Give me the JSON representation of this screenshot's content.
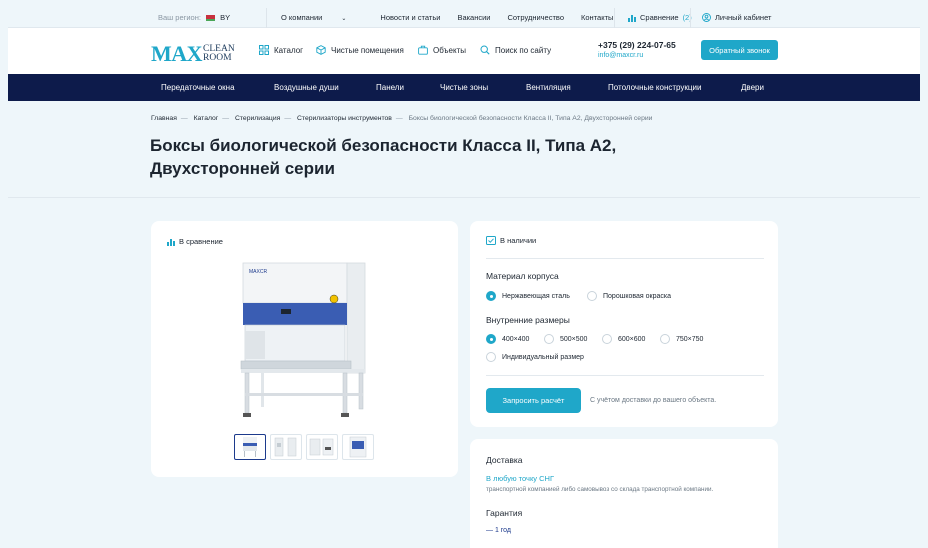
{
  "topbar": {
    "region_label": "Ваш регион:",
    "region_value": "BY",
    "nav": [
      "О компании",
      "Новости и статьи",
      "Вакансии",
      "Сотрудничество",
      "Контакты"
    ],
    "compare_label": "Сравнение",
    "compare_count": "(2)",
    "cabinet_label": "Личный кабинет"
  },
  "header": {
    "logo_max": "MAX",
    "logo_clean": "CLEAN",
    "logo_room": "ROOM",
    "nav": [
      "Каталог",
      "Чистые помещения",
      "Объекты",
      "Поиск по сайту"
    ],
    "phone": "+375 (29) 224-07-65",
    "email": "info@maxcr.ru",
    "callback_button": "Обратный звонок"
  },
  "main_nav": [
    "Передаточные окна",
    "Воздушные души",
    "Панели",
    "Чистые зоны",
    "Вентиляция",
    "Потолочные конструкции",
    "Двери"
  ],
  "breadcrumbs": [
    "Главная",
    "Каталог",
    "Стерилизация",
    "Стерилизаторы инструментов",
    "Боксы биологической безопасности Класса II, Типа А2, Двухсторонней серии"
  ],
  "page_title": "Боксы биологической безопасности Класса II, Типа А2, Двухсторонней серии",
  "product": {
    "compare_link": "В сравнение",
    "brand_mark": "MAXCR",
    "thumbnail_count": 4,
    "active_thumbnail": 1
  },
  "options": {
    "stock_status": "В наличии",
    "material_title": "Материал корпуса",
    "material_options": [
      "Нержавеющая сталь",
      "Порошковая окраска"
    ],
    "material_selected": "Нержавеющая сталь",
    "size_title": "Внутренние размеры",
    "size_options": [
      "400×400",
      "500×500",
      "600×600",
      "750×750",
      "Индивидуальный размер"
    ],
    "size_selected": "400×400",
    "request_button": "Запросить расчёт",
    "request_note": "С учётом доставки до вашего объекта."
  },
  "delivery": {
    "title": "Доставка",
    "link": "В любую точку СНГ",
    "description": "транспортной компанией либо самовывоз со склада транспортной компании.",
    "warranty_title": "Гарантия",
    "warranty_value": "— 1 год"
  },
  "colors": {
    "accent": "#1fa7c9",
    "navy": "#0d1b4b",
    "background": "#eef6fa"
  }
}
